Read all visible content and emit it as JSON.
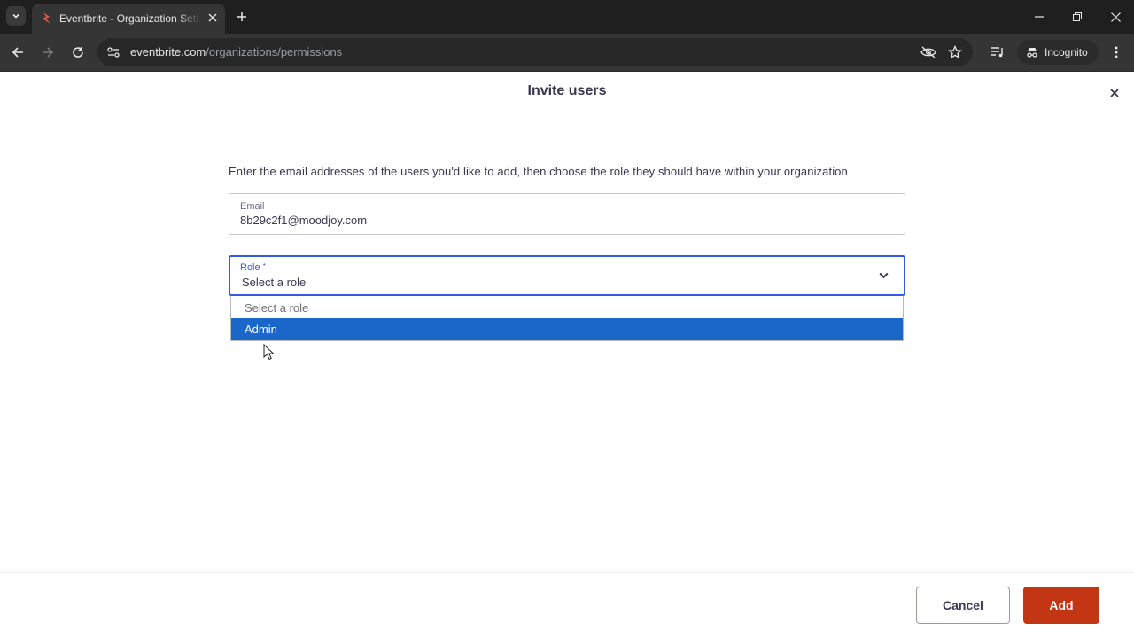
{
  "browser": {
    "tab_title": "Eventbrite - Organization Settings",
    "url_host": "eventbrite.com",
    "url_path": "/organizations/permissions",
    "incognito_label": "Incognito"
  },
  "modal": {
    "title": "Invite users",
    "intro": "Enter the email addresses of the users you'd like to add, then choose the role they should have within your organization",
    "email_label": "Email",
    "email_value": "8b29c2f1@moodjoy.com",
    "role_label": "Role",
    "role_required_mark": "*",
    "role_value": "Select a role",
    "role_options": [
      "Select a role",
      "Admin"
    ],
    "role_highlighted_option": "Admin",
    "cancel_label": "Cancel",
    "add_label": "Add"
  },
  "colors": {
    "brand_orange": "#c33614",
    "focus_blue": "#3659e3",
    "option_highlight": "#1a66c9",
    "text_dark": "#39364f"
  }
}
